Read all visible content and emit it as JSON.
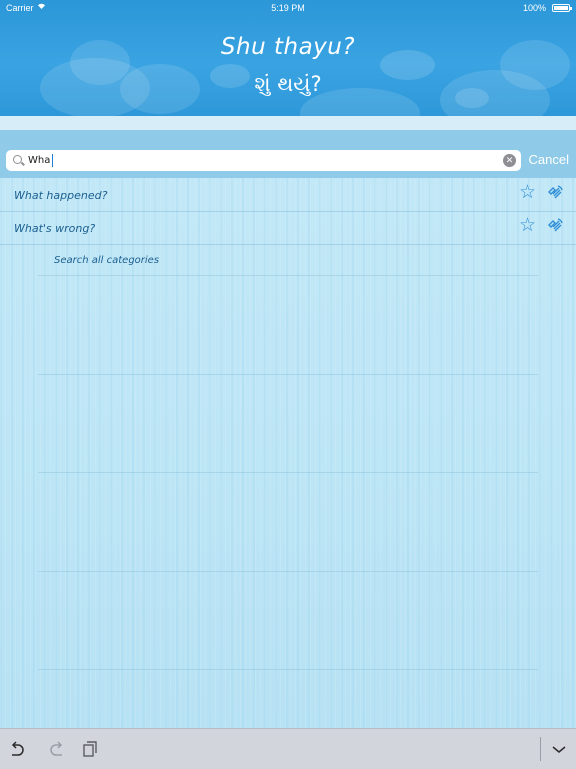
{
  "status_bar": {
    "carrier": "Carrier",
    "time": "5:19 PM",
    "battery": "100%"
  },
  "header": {
    "phrase_roman": "Shu thayu?",
    "phrase_native": "શું થયું?"
  },
  "search": {
    "value": "Wha",
    "cancel_label": "Cancel"
  },
  "results": [
    {
      "text": "What happened?"
    },
    {
      "text": "What's wrong?"
    }
  ],
  "search_all_label": "Search all categories",
  "colors": {
    "header_blue": "#2b97d8",
    "accent": "#2f8fd6",
    "text_blue": "#1b5f8f"
  },
  "icons": {
    "search": "search-icon",
    "clear": "clear-icon",
    "favorite": "star-icon",
    "audio": "speaker-icon",
    "undo": "undo-icon",
    "redo": "redo-icon",
    "clipboard": "clipboard-icon",
    "dismiss_keyboard": "chevron-down-icon"
  }
}
